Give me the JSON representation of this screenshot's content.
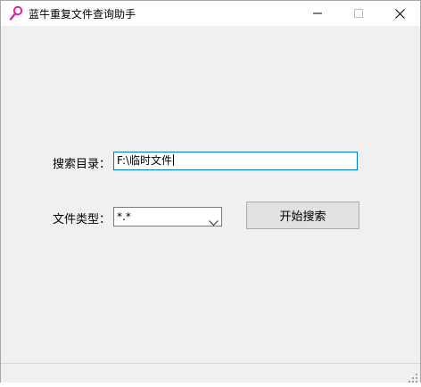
{
  "window": {
    "title": "蓝牛重复文件查询助手"
  },
  "form": {
    "dir_label": "搜索目录：",
    "dir_value": "F:\\临时文件",
    "type_label": "文件类型：",
    "type_value": "*.*",
    "search_button": "开始搜索"
  },
  "colors": {
    "accent": "#0078d7",
    "window_bg": "#f0f0f0",
    "icon_magenta": "#e0249a"
  },
  "icons": {
    "app": "magnifier-icon",
    "minimize": "minimize-icon",
    "maximize": "maximize-icon",
    "close": "close-icon",
    "dropdown": "chevron-down-icon",
    "grip": "resize-grip-icon"
  }
}
